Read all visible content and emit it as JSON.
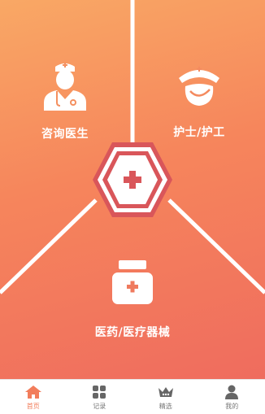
{
  "tiles": {
    "doctor": {
      "label": "咨询医生",
      "icon": "doctor-icon"
    },
    "nurse": {
      "label": "护士/护工",
      "icon": "nurse-icon"
    },
    "medicine": {
      "label": "医药/医疗器械",
      "icon": "medicine-bottle-icon"
    }
  },
  "center": {
    "icon": "medical-cross-icon"
  },
  "tabbar": {
    "items": [
      {
        "label": "首页",
        "icon": "home-icon",
        "active": true
      },
      {
        "label": "记录",
        "icon": "grid-icon",
        "active": false
      },
      {
        "label": "精选",
        "icon": "crown-icon",
        "active": false
      },
      {
        "label": "我的",
        "icon": "user-icon",
        "active": false
      }
    ]
  },
  "colors": {
    "accent": "#f27d5b",
    "hex_red": "#d9565a",
    "inactive": "#777777"
  }
}
